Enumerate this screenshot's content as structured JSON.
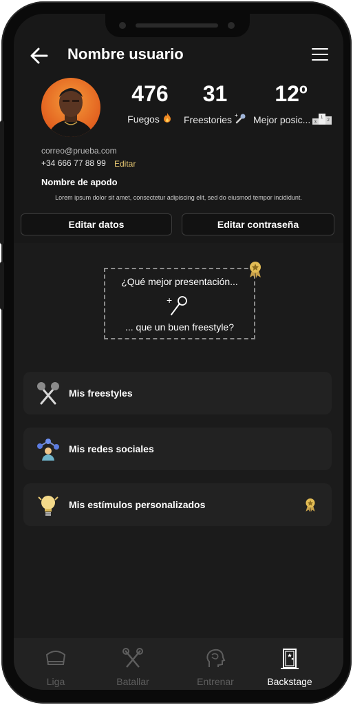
{
  "header": {
    "title": "Nombre usuario"
  },
  "stats": [
    {
      "value": "476",
      "label": "Fuegos"
    },
    {
      "value": "31",
      "label": "Freestories"
    },
    {
      "value": "12º",
      "label": "Mejor posic..."
    }
  ],
  "profile": {
    "email": "correo@prueba.com",
    "phone": "+34 666 77 88 99",
    "edit_label": "Editar",
    "nickname": "Nombre de apodo",
    "bio": "Lorem ipsum dolor sit amet, consectetur adipiscing elit, sed do eiusmod tempor incididunt."
  },
  "buttons": {
    "edit_data": "Editar datos",
    "edit_password": "Editar contraseña"
  },
  "presentation": {
    "line1": "¿Qué mejor presentación...",
    "line2": "... que un buen freestyle?",
    "plus": "+"
  },
  "rows": [
    {
      "label": "Mis freestyles"
    },
    {
      "label": "Mis redes sociales"
    },
    {
      "label": "Mis estímulos personalizados"
    }
  ],
  "podium_numbers": [
    "3",
    "1",
    "2"
  ],
  "tabs": [
    {
      "label": "Liga",
      "active": false
    },
    {
      "label": "Batallar",
      "active": false
    },
    {
      "label": "Entrenar",
      "active": false
    },
    {
      "label": "Backstage",
      "active": true
    }
  ],
  "colors": {
    "accent": "#e8c872",
    "background": "#181818",
    "card": "#222222"
  }
}
